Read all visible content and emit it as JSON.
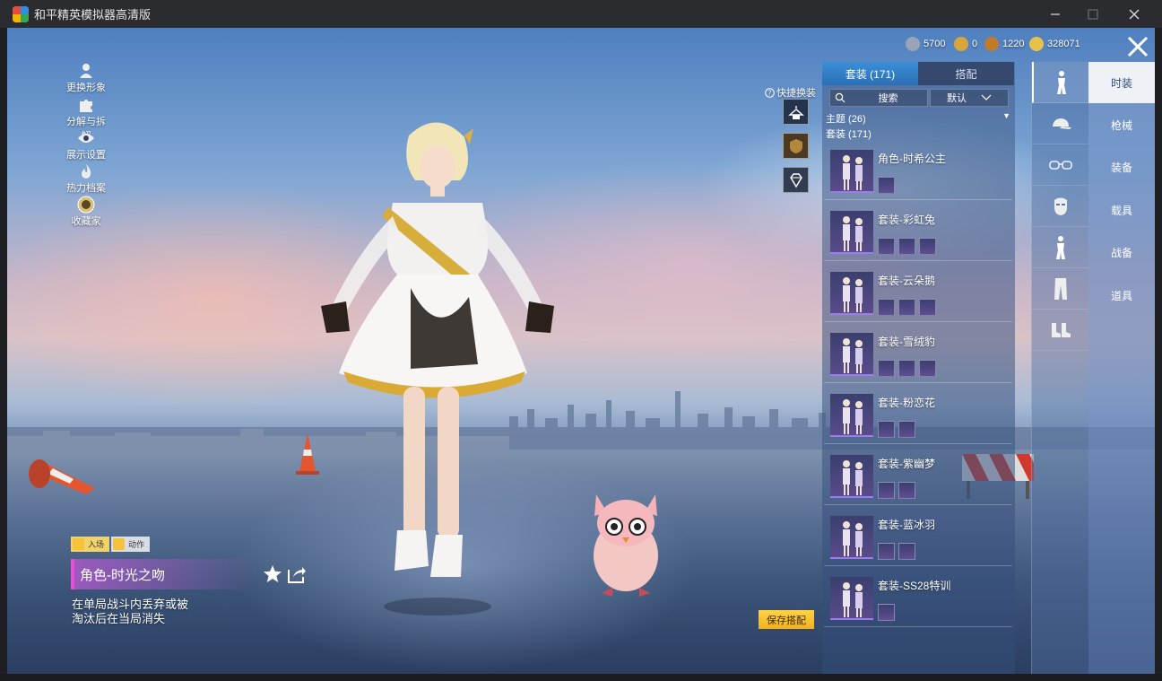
{
  "window": {
    "title": "和平精英模拟器高清版",
    "controls": [
      "minimize",
      "maximize",
      "close"
    ]
  },
  "left_menu": [
    {
      "label": "更换形象",
      "icon": "person-icon"
    },
    {
      "label": "分解与拆解",
      "icon": "puzzle-icon"
    },
    {
      "label": "展示设置",
      "icon": "eye-icon"
    },
    {
      "label": "热力档案",
      "icon": "flame-icon"
    },
    {
      "label": "收藏家",
      "icon": "collector-badge-icon"
    }
  ],
  "currency": [
    {
      "value": "5700",
      "color": "#9aa4b8"
    },
    {
      "value": "0",
      "color": "#d7a53a"
    },
    {
      "value": "1220",
      "color": "#c07a2b"
    },
    {
      "value": "328071",
      "color": "#e6c24a"
    }
  ],
  "quick": {
    "label": "快捷换装"
  },
  "panel": {
    "tabs": [
      {
        "label": "套装 (171)",
        "active": true
      },
      {
        "label": "搭配",
        "active": false
      }
    ],
    "search_placeholder": "搜索",
    "sort_label": "默认",
    "theme_label": "主题 (26)",
    "suits_label": "套装 (171)",
    "suits": [
      {
        "name": "角色-时希公主",
        "pieces": 1
      },
      {
        "name": "套装-彩虹兔",
        "pieces": 3
      },
      {
        "name": "套装-云朵鹅",
        "pieces": 3
      },
      {
        "name": "套装-雪绒豹",
        "pieces": 3
      },
      {
        "name": "套装-粉恋花",
        "pieces": 2
      },
      {
        "name": "套装-紫幽梦",
        "pieces": 2
      },
      {
        "name": "套装-蓝冰羽",
        "pieces": 2
      },
      {
        "name": "套装-SS28特训",
        "pieces": 1
      }
    ],
    "save_label": "保存搭配"
  },
  "categories": [
    {
      "icon": "full-body-icon",
      "active": true
    },
    {
      "icon": "cap-icon",
      "active": false
    },
    {
      "icon": "goggles-icon",
      "active": false
    },
    {
      "icon": "mask-icon",
      "active": false
    },
    {
      "icon": "outfit-icon",
      "active": false
    },
    {
      "icon": "pants-icon",
      "active": false
    },
    {
      "icon": "shoes-icon",
      "active": false
    }
  ],
  "right_nav": [
    {
      "label": "时装",
      "active": true
    },
    {
      "label": "枪械",
      "active": false
    },
    {
      "label": "装备",
      "active": false
    },
    {
      "label": "载具",
      "active": false
    },
    {
      "label": "战备",
      "active": false
    },
    {
      "label": "道具",
      "active": false
    }
  ],
  "bottom_left": {
    "tabs": [
      {
        "label": "入场"
      },
      {
        "label": "动作"
      }
    ],
    "skin_name": "角色-时光之吻",
    "description_line1": "在单局战斗内丢弃或被",
    "description_line2": "淘汰后在当局消失"
  }
}
